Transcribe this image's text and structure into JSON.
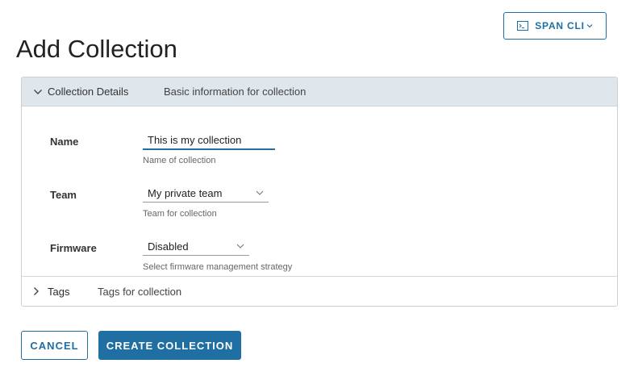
{
  "header": {
    "span_cli_label": "SPAN CLI",
    "page_title": "Add Collection"
  },
  "sections": {
    "details": {
      "title": "Collection Details",
      "description": "Basic information for collection"
    },
    "tags": {
      "title": "Tags",
      "description": "Tags for collection"
    }
  },
  "form": {
    "name": {
      "label": "Name",
      "value": "This is my collection",
      "helper": "Name of collection"
    },
    "team": {
      "label": "Team",
      "selected": "My private team",
      "helper": "Team for collection"
    },
    "firmware": {
      "label": "Firmware",
      "selected": "Disabled",
      "helper": "Select firmware management strategy"
    }
  },
  "actions": {
    "cancel_label": "CANCEL",
    "create_label": "CREATE COLLECTION"
  },
  "colors": {
    "accent": "#1f6fa3",
    "section_header_bg": "#dfe6ec"
  },
  "icons": {
    "cli": "terminal-icon",
    "expanded": "chevron-down-icon",
    "collapsed": "chevron-right-icon",
    "dropdown": "chevron-down-icon"
  }
}
